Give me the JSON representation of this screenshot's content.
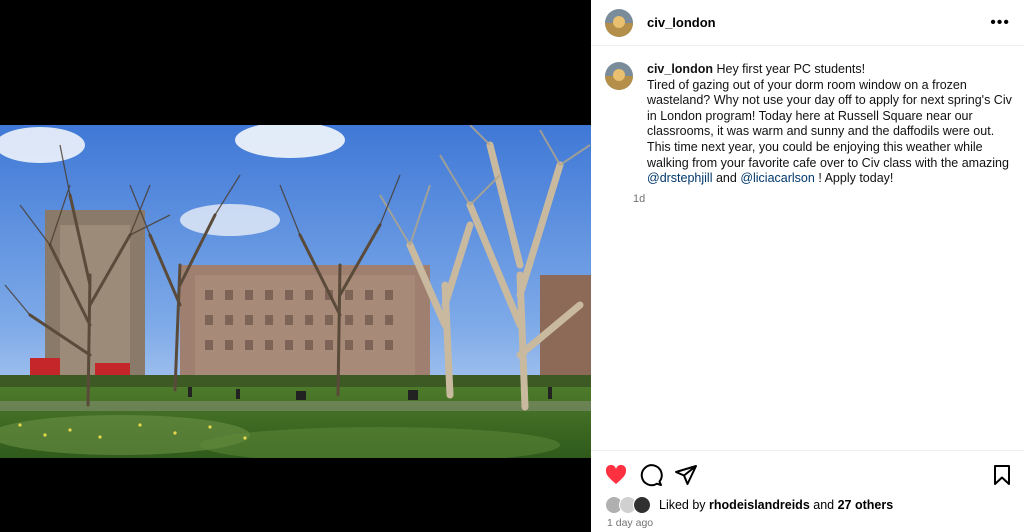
{
  "post": {
    "username": "civ_london",
    "caption_username": "civ_london",
    "caption_parts": [
      "Hey first year PC students!",
      "Tired of gazing out of your dorm room window on a frozen wasteland? Why not use your day off to apply for next spring's Civ in London program! Today here at Russell Square near our classrooms, it was warm and sunny and the daffodils were out. This time next year, you could be enjoying this weather while walking from your favorite cafe over to Civ class with the amazing "
    ],
    "mention1": "@drstephjill",
    "and_text": " and ",
    "mention2": "@liciacarlson",
    "caption_end": " ! Apply today!",
    "caption_age": "1d",
    "liked_by_prefix": "Liked by ",
    "liked_by_user": "rhodeislandreids",
    "liked_by_mid": " and ",
    "liked_by_count": "27 others",
    "posted": "1 day ago"
  },
  "icons": {
    "more": "more-options-icon",
    "like": "heart-filled-icon",
    "comment": "comment-icon",
    "share": "send-icon",
    "save": "bookmark-icon"
  },
  "colors": {
    "like": "#ff3040",
    "mention": "#00376b",
    "muted": "#737373"
  }
}
